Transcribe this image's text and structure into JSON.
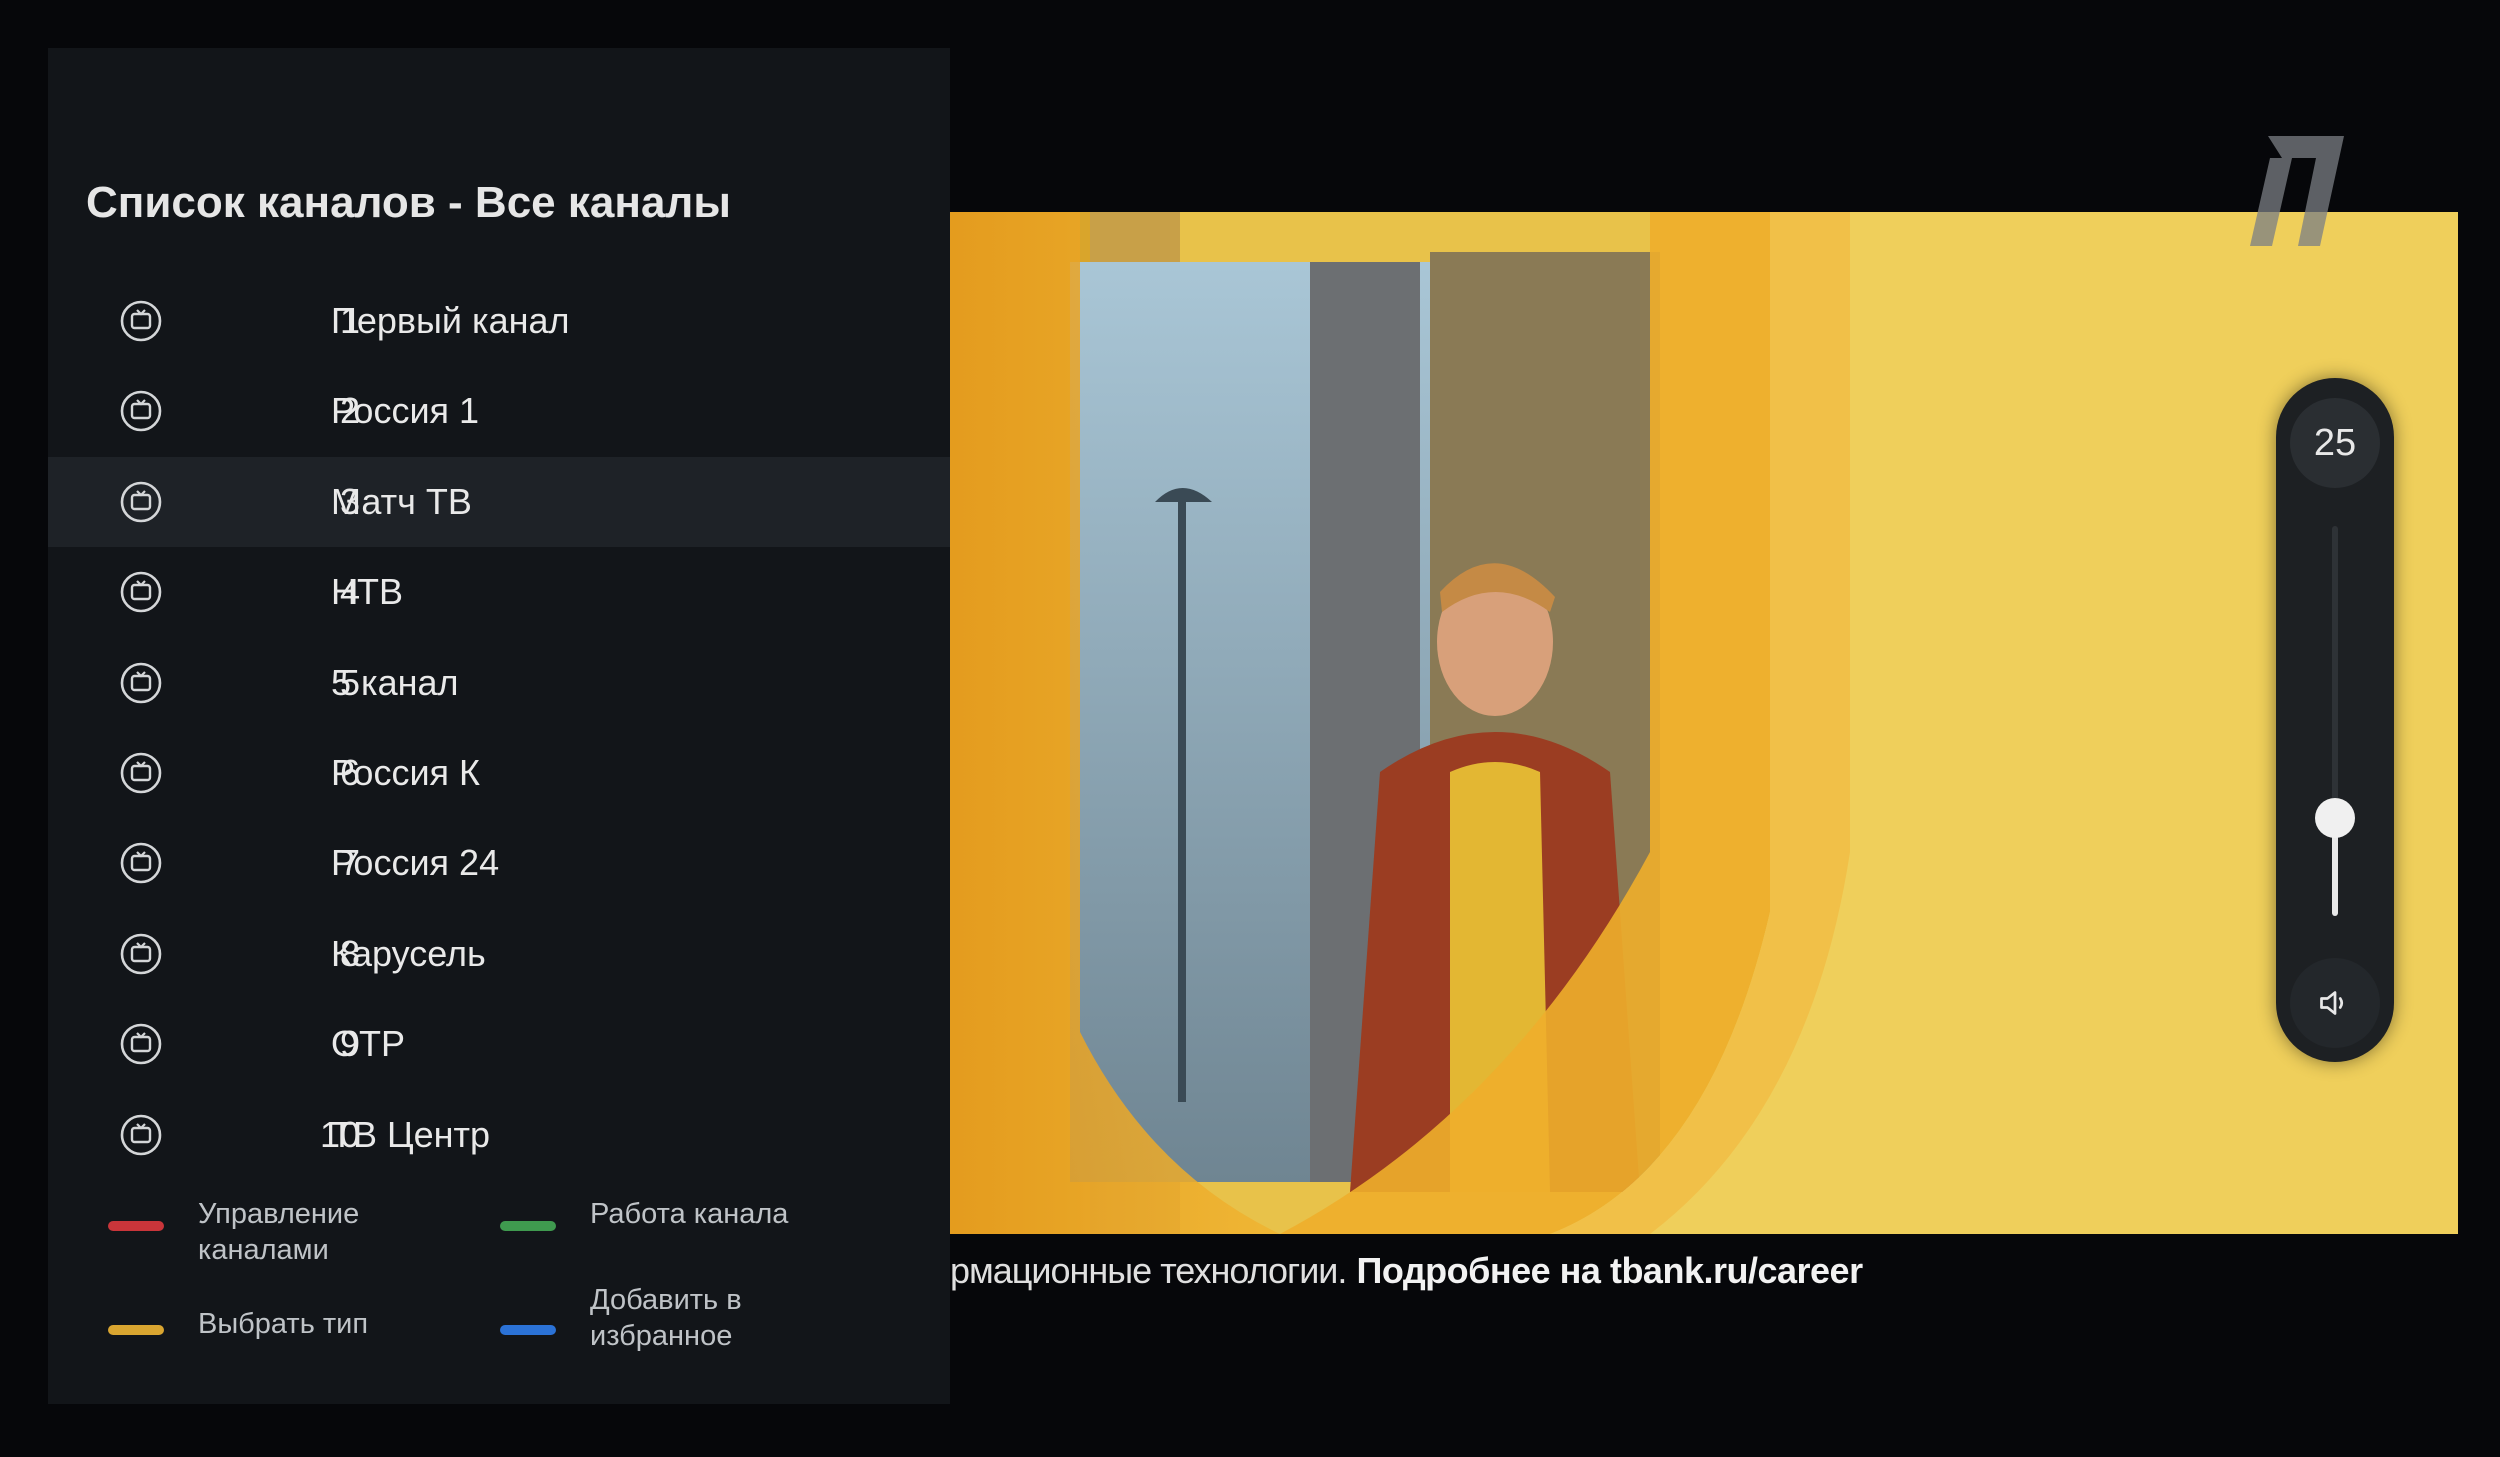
{
  "panel": {
    "title": "Список каналов - Все каналы",
    "channels": [
      {
        "number": "1",
        "name": "Первый канал"
      },
      {
        "number": "2",
        "name": "Россия 1"
      },
      {
        "number": "3",
        "name": "Матч ТВ"
      },
      {
        "number": "4",
        "name": "НТВ"
      },
      {
        "number": "5",
        "name": "5 канал"
      },
      {
        "number": "6",
        "name": "Россия К"
      },
      {
        "number": "7",
        "name": "Россия 24"
      },
      {
        "number": "8",
        "name": "Карусель"
      },
      {
        "number": "9",
        "name": "ОТР"
      },
      {
        "number": "10",
        "name": "ТВ Центр"
      }
    ],
    "selected_channel": "3",
    "legend": {
      "red": {
        "label": "Управление каналами",
        "color": "#c9353a"
      },
      "green": {
        "label": "Работа канала",
        "color": "#3f9a4f"
      },
      "yellow": {
        "label": "Выбрать тип",
        "color": "#d9a530"
      },
      "blue": {
        "label": "Добавить в избранное",
        "color": "#2b72d6"
      }
    }
  },
  "video": {
    "ticker_prefix": "рмационные технологии.",
    "ticker_main": "Подробнее на tbank.ru/career"
  },
  "volume": {
    "value": "25",
    "level": 0.25,
    "icon": "speaker-icon"
  },
  "logo": {
    "icon": "channel-one-logo"
  }
}
